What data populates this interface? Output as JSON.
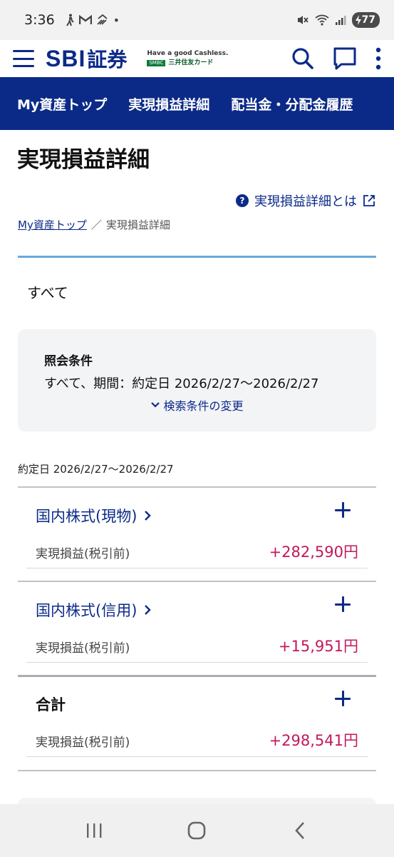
{
  "status_bar": {
    "time": "3:36",
    "battery": "77"
  },
  "header": {
    "logo_sbi": "SBI",
    "logo_shoken": "証券",
    "tagline": "Have a good Cashless.",
    "partner_badge": "SMBC",
    "partner_text": "三井住友カード"
  },
  "nav": {
    "items": [
      "My資産トップ",
      "実現損益詳細",
      "配当金・分配金履歴"
    ]
  },
  "page": {
    "title": "実現損益詳細",
    "help_link": "実現損益詳細とは",
    "breadcrumb": {
      "home": "My資産トップ",
      "separator": "／",
      "current": "実現損益詳細"
    },
    "filter_label": "すべて"
  },
  "conditions": {
    "title": "照会条件",
    "text": "すべて、期間：約定日 2026/2/27〜2026/2/27",
    "change_label": "検索条件の変更"
  },
  "period_label": "約定日 2026/2/27〜2026/2/27",
  "sections": [
    {
      "title": "国内株式(現物)",
      "label": "実現損益(税引前)",
      "value": "+282,590円"
    },
    {
      "title": "国内株式(信用)",
      "label": "実現損益(税引前)",
      "value": "+15,951円"
    },
    {
      "title": "合計",
      "label": "実現損益(税引前)",
      "value": "+298,541円"
    }
  ],
  "colors": {
    "brand": "#0b2a88",
    "accent_line": "#6aa7dc",
    "profit": "#c2185b"
  }
}
